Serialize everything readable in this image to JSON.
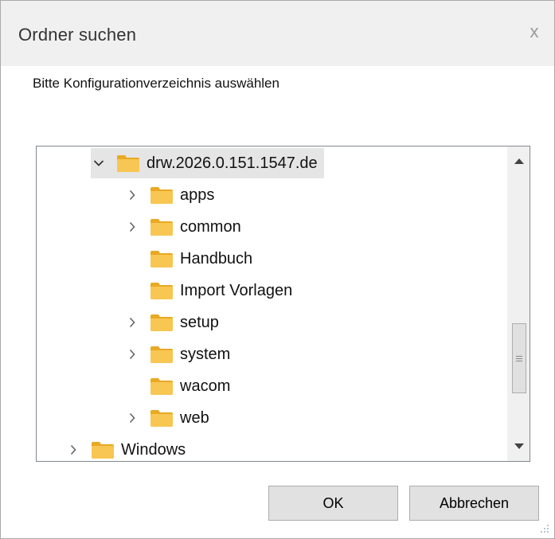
{
  "dialog": {
    "title": "Ordner suchen",
    "close_glyph": "x",
    "prompt": "Bitte Konfigurationverzeichnis auswählen"
  },
  "tree": {
    "selected": "drw.2026.0.151.1547.de",
    "items": [
      {
        "label": "drw.2026.0.151.1547.de",
        "expander": "expanded",
        "level": 2,
        "icon": "folder-icon"
      },
      {
        "label": "apps",
        "expander": "collapsed",
        "level": 3,
        "icon": "folder-icon"
      },
      {
        "label": "common",
        "expander": "collapsed",
        "level": 3,
        "icon": "folder-icon"
      },
      {
        "label": "Handbuch",
        "expander": "none",
        "level": 3,
        "icon": "folder-icon"
      },
      {
        "label": "Import Vorlagen",
        "expander": "none",
        "level": 3,
        "icon": "folder-icon"
      },
      {
        "label": "setup",
        "expander": "collapsed",
        "level": 3,
        "icon": "folder-icon"
      },
      {
        "label": "system",
        "expander": "collapsed",
        "level": 3,
        "icon": "folder-icon"
      },
      {
        "label": "wacom",
        "expander": "none",
        "level": 3,
        "icon": "folder-icon"
      },
      {
        "label": "web",
        "expander": "collapsed",
        "level": 3,
        "icon": "folder-icon"
      },
      {
        "label": "Windows",
        "expander": "collapsed",
        "level": 1,
        "icon": "folder-icon"
      }
    ]
  },
  "buttons": {
    "ok": "OK",
    "cancel": "Abbrechen"
  },
  "colors": {
    "folder": "#f8c652",
    "folder_dark": "#e9a923",
    "selection": "#e5e5e5",
    "button_face": "#e1e1e1"
  }
}
